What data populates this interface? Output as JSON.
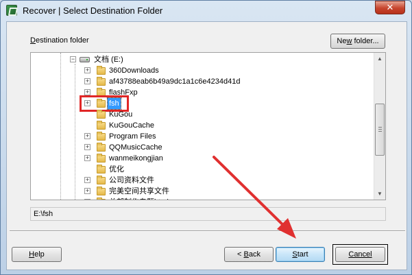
{
  "window": {
    "title": "Recover | Select Destination Folder",
    "close_glyph": "✕"
  },
  "labels": {
    "destination_folder_pre": "D",
    "destination_folder_rest": "estination folder"
  },
  "buttons": {
    "new_folder_pre": "Ne",
    "new_folder_u": "w",
    "new_folder_rest": " folder...",
    "help_u": "H",
    "help_rest": "elp",
    "back_pre": "< ",
    "back_u": "B",
    "back_rest": "ack",
    "start_u": "S",
    "start_rest": "tart",
    "cancel": "Cancel"
  },
  "tree": {
    "drive_label": "文档 (E:)",
    "items": [
      {
        "label": "360Downloads",
        "expandable": true
      },
      {
        "label": "af43788eab6b49a9dc1a1c6e4234d41d",
        "expandable": true
      },
      {
        "label": "flashFxp",
        "expandable": true
      },
      {
        "label": "fsh",
        "expandable": true,
        "selected": true
      },
      {
        "label": "KuGou",
        "expandable": false
      },
      {
        "label": "KuGouCache",
        "expandable": false
      },
      {
        "label": "Program Files",
        "expandable": true
      },
      {
        "label": "QQMusicCache",
        "expandable": true
      },
      {
        "label": "wanmeikongjian",
        "expandable": true
      },
      {
        "label": "优化",
        "expandable": false
      },
      {
        "label": "公司资料文件",
        "expandable": true
      },
      {
        "label": "完美空间共享文件",
        "expandable": true
      },
      {
        "label": "总部制作专题html",
        "expandable": true
      }
    ]
  },
  "path": {
    "value": "E:\\fsh"
  },
  "colors": {
    "selection": "#3399ff",
    "highlight": "#e02626",
    "annotation_arrow": "#e03030"
  }
}
